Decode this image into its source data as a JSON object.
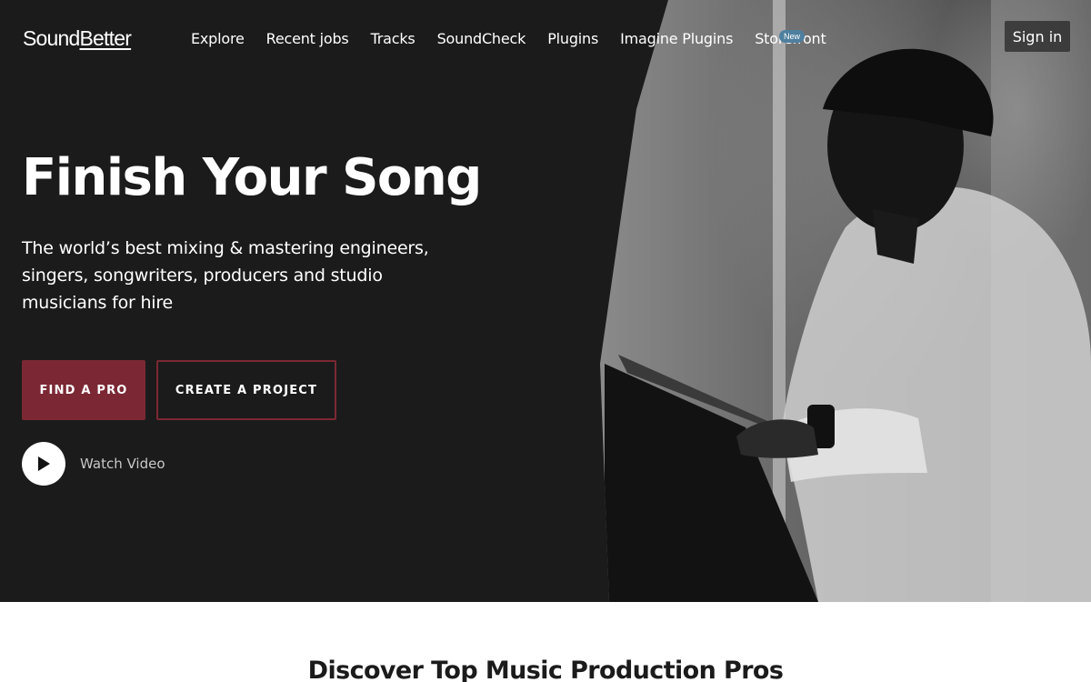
{
  "brand": {
    "logo_text_part1": "Sound",
    "logo_text_part2": "Better"
  },
  "nav": {
    "links": [
      "Explore",
      "Recent jobs",
      "Tracks",
      "SoundCheck",
      "Plugins",
      "Imagine Plugins",
      "Storefront"
    ],
    "badge": "New",
    "sign_in": "Sign in"
  },
  "hero": {
    "title": "Finish Your Song",
    "subtitle": "The world’s best mixing & mastering engineers, singers, songwriters, producers and studio musicians for hire",
    "primary_button": "FIND A PRO",
    "secondary_button": "CREATE A PROJECT",
    "watch_video": "Watch Video"
  },
  "section": {
    "title": "Discover Top Music Production Pros"
  },
  "colors": {
    "hero_background": "#1b1b1b",
    "accent": "#7b2834",
    "badge": "#4e7f9f"
  },
  "icons": {
    "play": "play-icon"
  }
}
